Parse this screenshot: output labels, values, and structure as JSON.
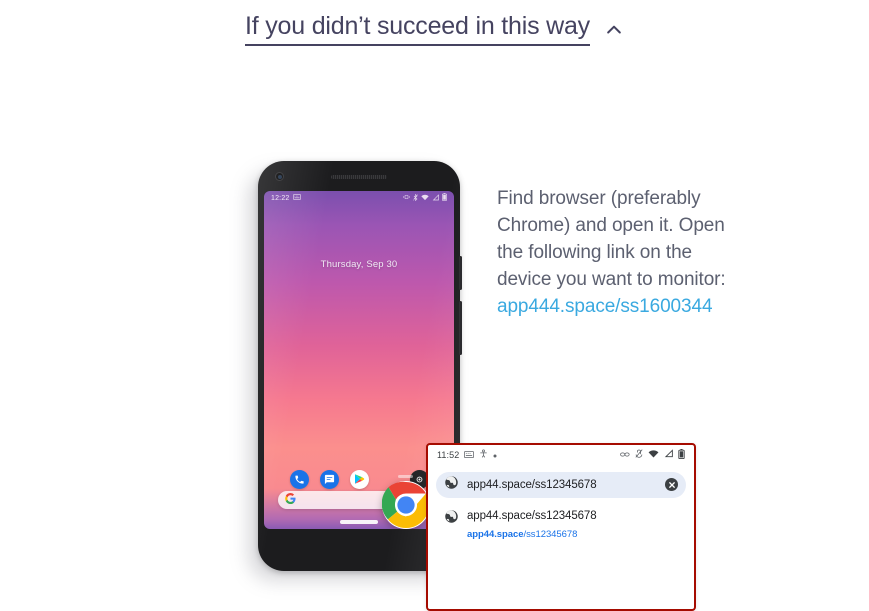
{
  "header": {
    "title": "If you didn’t succeed in this way",
    "chevron_icon": "chevron-up-icon",
    "text_color": "#454360"
  },
  "instructions": {
    "body": "Find browser (preferably Chrome) and open it. Open the following link on the device you want to monitor:",
    "link_text": "app444.space/ss1600344",
    "link_color": "#3aa9e0",
    "body_color": "#5c6070"
  },
  "phone": {
    "status_bar": {
      "time": "12:22",
      "left_icons": [
        "keyboard-icon"
      ],
      "right_icons": [
        "vibrate-icon",
        "bluetooth-icon",
        "wifi-icon",
        "signal-icon",
        "battery-icon"
      ]
    },
    "lock_screen": {
      "date": "Thursday, Sep 30"
    },
    "dock": {
      "apps": [
        {
          "name": "phone-app-icon",
          "label": "Phone",
          "color": "#1a73e8"
        },
        {
          "name": "messages-app-icon",
          "label": "Messages",
          "color": "#1a73e8"
        },
        {
          "name": "play-store-app-icon",
          "label": "Play Store",
          "color": "#ffffff"
        },
        {
          "name": "chrome-app-icon",
          "label": "Chrome",
          "color": "#ffffff"
        },
        {
          "name": "camera-app-icon",
          "label": "Camera",
          "color": "#202124"
        }
      ]
    },
    "search_bar": {
      "logo": "google-g-icon",
      "placeholder": "",
      "mic_icon": "google-assistant-dot-icon"
    },
    "wallpaper_colors": [
      "#7b4fae",
      "#bd58ad",
      "#f6798f",
      "#8a5bb5"
    ]
  },
  "browser_card": {
    "border_color": "#a50b00",
    "status_bar": {
      "time": "11:52",
      "left_icons": [
        "keyboard-icon",
        "accessibility-icon",
        "dot-icon"
      ],
      "right_icons": [
        "link-icon",
        "mute-icon",
        "wifi-icon",
        "signal-icon",
        "battery-icon"
      ]
    },
    "omnibox": {
      "leading_icon": "globe-icon",
      "value": "app44.space/ss12345678",
      "clear_icon": "clear-x-icon"
    },
    "suggestion": {
      "leading_icon": "globe-icon",
      "title": "app44.space/ss12345678",
      "subtitle_bold": "app44.space",
      "subtitle_rest": "/ss12345678",
      "subtitle_color": "#1a73e8"
    }
  }
}
